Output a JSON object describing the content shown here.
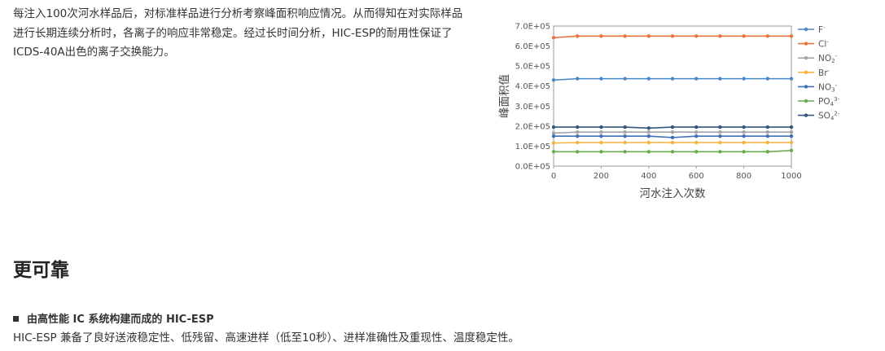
{
  "intro": {
    "text": "每注入100次河水样品后，对标准样品进行分析考察峰面积响应情况。从而得知在对实际样品进行长期连续分析时，各离子的响应非常稳定。经过长时间分析，HIC-ESP的耐用性保证了ICDS-40A出色的离子交换能力。"
  },
  "section": {
    "heading": "更可靠"
  },
  "feature": {
    "bullet_icon": "square-bullet-icon",
    "title": "由高性能 IC 系统构建而成的 HIC-ESP",
    "description": "HIC-ESP 兼备了良好送液稳定性、低残留、高速进样（低至10秒）、进样准确性及重现性、温度稳定性。"
  },
  "chart_data": {
    "type": "line",
    "title": "",
    "xlabel": "河水注入次数",
    "ylabel": "峰面积值",
    "x": [
      0,
      100,
      200,
      300,
      400,
      500,
      600,
      700,
      800,
      900,
      1000
    ],
    "xlim": [
      0,
      1000
    ],
    "ylim": [
      0,
      700000
    ],
    "xticks": [
      "0",
      "200",
      "400",
      "600",
      "800",
      "1000"
    ],
    "yticks": [
      "0.0E+05",
      "1.0E+05",
      "2.0E+05",
      "3.0E+05",
      "4.0E+05",
      "5.0E+05",
      "6.0E+05",
      "7.0E+05"
    ],
    "grid": false,
    "legend_position": "right",
    "series": [
      {
        "name": "F",
        "charge": "-",
        "color": "#4a86c8",
        "values": [
          430000,
          437000,
          437000,
          437000,
          437000,
          437000,
          437000,
          437000,
          437000,
          437000,
          437000
        ]
      },
      {
        "name": "Cl",
        "charge": "-",
        "color": "#e8743b",
        "values": [
          642000,
          650000,
          650000,
          650000,
          650000,
          650000,
          650000,
          650000,
          650000,
          650000,
          650000
        ]
      },
      {
        "name": "NO",
        "sub": "2",
        "charge": "-",
        "color": "#a5a5a5",
        "values": [
          165000,
          170000,
          170000,
          170000,
          170000,
          170000,
          170000,
          170000,
          170000,
          170000,
          170000
        ]
      },
      {
        "name": "Br",
        "charge": "-",
        "color": "#f5b23f",
        "values": [
          115000,
          118000,
          118000,
          118000,
          118000,
          118000,
          118000,
          118000,
          118000,
          118000,
          118000
        ]
      },
      {
        "name": "NO",
        "sub": "3",
        "charge": "-",
        "color": "#3f6fb5",
        "values": [
          150000,
          150000,
          150000,
          150000,
          150000,
          143000,
          150000,
          150000,
          150000,
          150000,
          150000
        ]
      },
      {
        "name": "PO",
        "sub": "4",
        "charge": "3-",
        "color": "#6aab4f",
        "values": [
          72000,
          72000,
          72000,
          72000,
          72000,
          72000,
          72000,
          72000,
          72000,
          72000,
          78000
        ]
      },
      {
        "name": "SO",
        "sub": "4",
        "charge": "2-",
        "color": "#34577d",
        "values": [
          195000,
          195000,
          195000,
          195000,
          190000,
          195000,
          195000,
          195000,
          195000,
          195000,
          195000
        ]
      }
    ]
  }
}
